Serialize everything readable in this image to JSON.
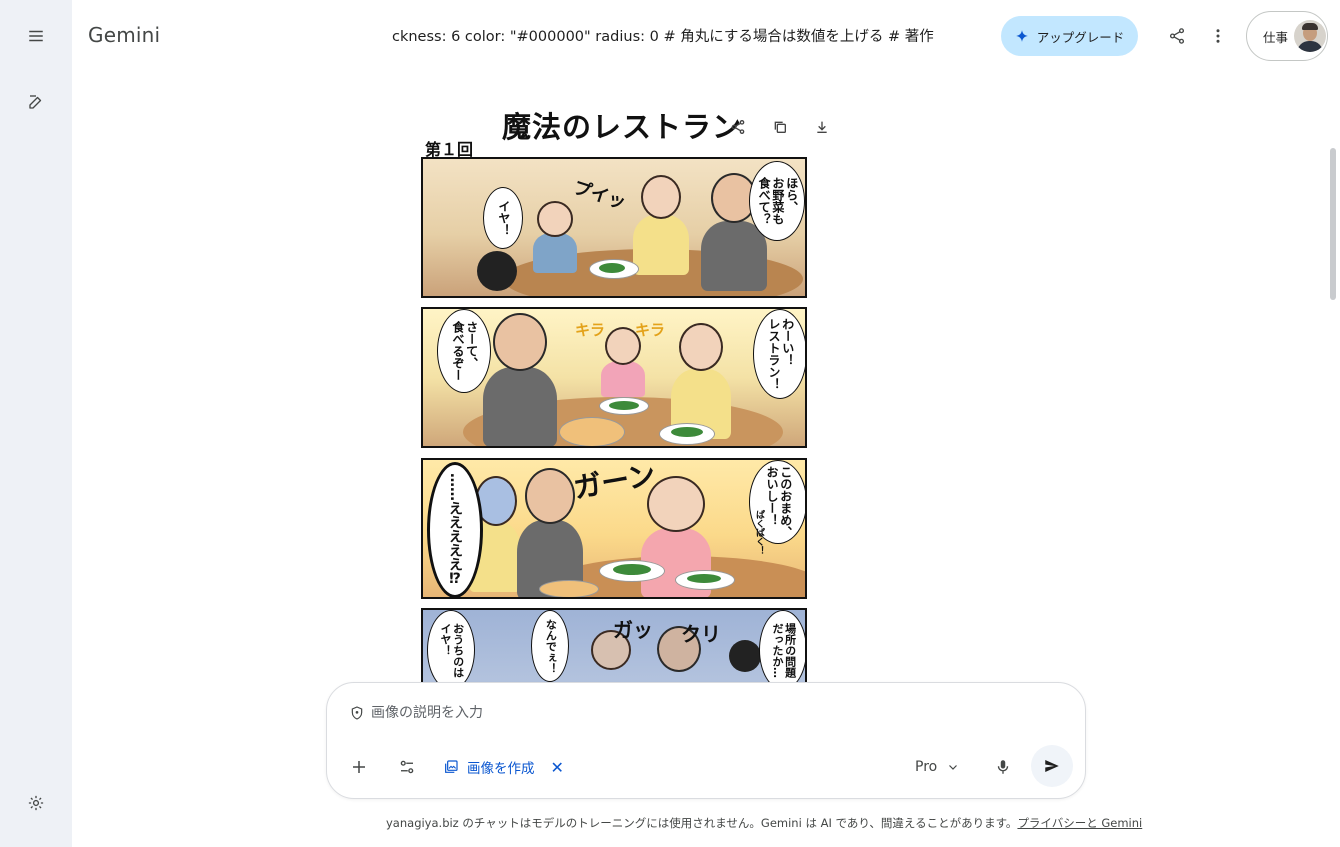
{
  "app": {
    "brand": "Gemini"
  },
  "rail": {
    "icons": [
      "menu-icon",
      "new-chat-icon",
      "settings-icon"
    ]
  },
  "header": {
    "title_strip": "ckness: 6     color: \"#000000\"     radius: 0 # 角丸にする場合は数値を上げる   # 著作",
    "upgrade_label": "アップグレード",
    "account_label": "仕事"
  },
  "image": {
    "title": "魔法のレストラン",
    "episode": "第１回",
    "panels": [
      {
        "bubbles": [
          "ほら、\nお野菜も\n食べて？",
          "イヤ！"
        ],
        "sfx": [
          "プイッ"
        ]
      },
      {
        "bubbles": [
          "わーい！\nレストラン！",
          "さーて、\n食べるぞー"
        ],
        "sfx": [
          "キラ",
          "キラ"
        ]
      },
      {
        "bubbles": [
          "このおまめ、\nおいしー！",
          "……えええええ⁉"
        ],
        "sfx": [
          "ガーン",
          "ぱくぱく！"
        ]
      },
      {
        "bubbles": [
          "場所の問題\nだったか…",
          "なんでぇ！",
          "おうちのは\nイヤ！"
        ],
        "sfx": [
          "ガッ",
          "クリ"
        ]
      }
    ]
  },
  "prompt": {
    "placeholder": "画像の説明を入力",
    "chip_label": "画像を作成",
    "model": "Pro"
  },
  "footer": {
    "text": "yanagiya.biz のチャットはモデルのトレーニングには使用されません。Gemini は AI であり、間違えることがあります。",
    "link": "プライバシーと Gemini"
  },
  "colors": {
    "rail_bg": "#eef1f6",
    "upgrade_bg": "#c2e7ff",
    "accent": "#0b57d0"
  }
}
